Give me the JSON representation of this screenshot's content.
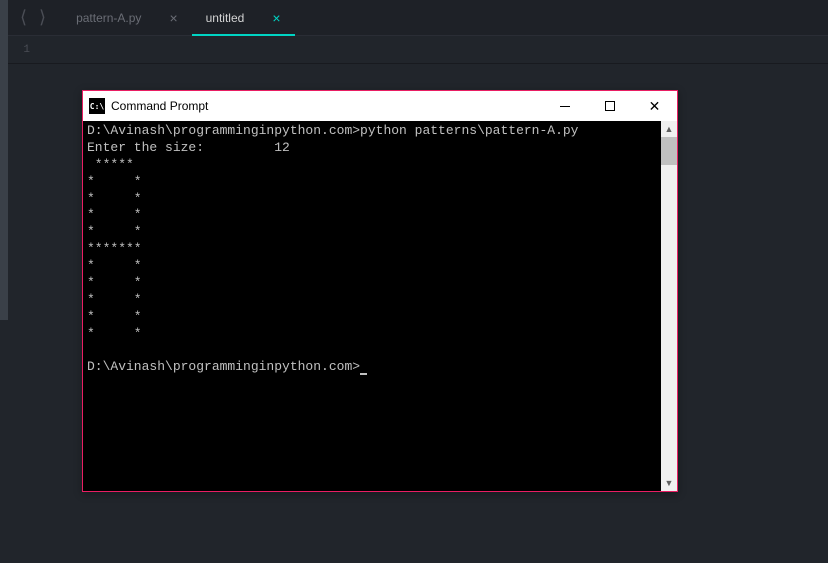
{
  "tabs": [
    {
      "label": "pattern-A.py",
      "active": false
    },
    {
      "label": "untitled",
      "active": true
    }
  ],
  "gutter": {
    "line1": "1"
  },
  "cmd": {
    "title": "Command Prompt",
    "icon_text": "C:\\",
    "output": "D:\\Avinash\\programminginpython.com>python patterns\\pattern-A.py\nEnter the size:         12\n *****\n*     *\n*     *\n*     *\n*     *\n*******\n*     *\n*     *\n*     *\n*     *\n*     *\n\nD:\\Avinash\\programminginpython.com>"
  }
}
